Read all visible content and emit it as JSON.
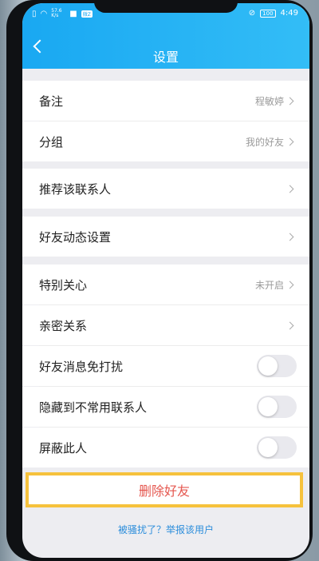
{
  "status_bar": {
    "network_speed": "57.6 K/s",
    "badge": "微Z",
    "battery": "100",
    "time": "4:49"
  },
  "header": {
    "title": "设置"
  },
  "rows": [
    {
      "label": "备注",
      "value": "程敏婷"
    },
    {
      "label": "分组",
      "value": "我的好友"
    },
    {
      "label": "推荐该联系人"
    },
    {
      "label": "好友动态设置"
    },
    {
      "label": "特别关心",
      "value": "未开启"
    },
    {
      "label": "亲密关系"
    },
    {
      "label": "好友消息免打扰",
      "toggle": false
    },
    {
      "label": "隐藏到不常用联系人",
      "toggle": false
    },
    {
      "label": "屏蔽此人",
      "toggle": false
    }
  ],
  "delete_label": "删除好友",
  "report_link": "被骚扰了？举报该用户",
  "colors": {
    "header": "#19a8f2",
    "delete_text": "#e5574f",
    "highlight_border": "#f6c23d",
    "link": "#2b8ddb"
  }
}
